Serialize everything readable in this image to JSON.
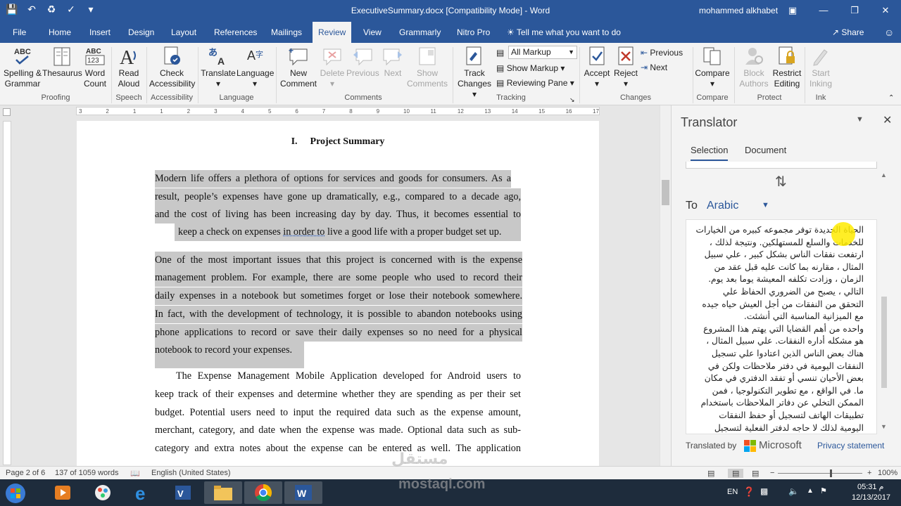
{
  "window": {
    "title": "ExecutiveSummary.docx [Compatibility Mode]  -  Word",
    "user": "mohammed alkhabet"
  },
  "tabs": [
    "File",
    "Home",
    "Insert",
    "Design",
    "Layout",
    "References",
    "Mailings",
    "Review",
    "View",
    "Grammarly",
    "Nitro Pro"
  ],
  "active_tab": "Review",
  "tell_me": "Tell me what you want to do",
  "share": "Share",
  "ribbon": {
    "proofing": {
      "spelling": "Spelling &",
      "spelling2": "Grammar",
      "thesaurus": "Thesaurus",
      "wordcount": "Word",
      "wordcount2": "Count",
      "group": "Proofing"
    },
    "speech": {
      "read": "Read",
      "read2": "Aloud",
      "group": "Speech"
    },
    "accessibility": {
      "check": "Check",
      "check2": "Accessibility",
      "group": "Accessibility"
    },
    "language": {
      "translate": "Translate",
      "language": "Language",
      "group": "Language"
    },
    "comments": {
      "new": "New",
      "new2": "Comment",
      "delete": "Delete",
      "previous": "Previous",
      "next": "Next",
      "show": "Show",
      "show2": "Comments",
      "group": "Comments"
    },
    "tracking": {
      "track": "Track",
      "track2": "Changes",
      "markup": "All Markup",
      "show_markup": "Show Markup",
      "reviewing": "Reviewing Pane",
      "group": "Tracking"
    },
    "changes": {
      "accept": "Accept",
      "reject": "Reject",
      "previous": "Previous",
      "next": "Next",
      "group": "Changes"
    },
    "compare": {
      "compare": "Compare",
      "group": "Compare"
    },
    "protect": {
      "block": "Block",
      "block2": "Authors",
      "restrict": "Restrict",
      "restrict2": "Editing",
      "group": "Protect"
    },
    "ink": {
      "start": "Start",
      "start2": "Inking",
      "group": "Ink"
    }
  },
  "ruler_numbers": [
    "3",
    "2",
    "1",
    "1",
    "2",
    "3",
    "4",
    "5",
    "6",
    "7",
    "8",
    "9",
    "10",
    "11",
    "12",
    "13",
    "14",
    "15",
    "16",
    "17"
  ],
  "document": {
    "heading_num": "I.",
    "heading": "Project Summary",
    "p1": [
      "Modern life offers a plethora of options for services and goods for consumers. As a",
      "result, people’s expenses have gone up dramatically, e.g., compared to a decade ago,",
      "and the cost of living has been increasing day by day. Thus, it becomes essential to"
    ],
    "p1_last_a": "keep a check on expenses ",
    "p1_last_ul": "in order to",
    "p1_last_b": " live a good life with a proper budget set up.",
    "p2": [
      "One of the most important issues that this project is concerned with is the expense",
      "management problem. For example, there are some people who used to record their",
      "daily expenses in a notebook but sometimes forget or lose their notebook somewhere.",
      "In fact, with the development of technology, it is possible to abandon notebooks using",
      "phone applications to record or save their daily expenses so no need for a physical"
    ],
    "p2_last": "notebook to record your expenses.",
    "p3": [
      "The Expense Management Mobile Application developed for Android users to",
      "keep track of their expenses and determine whether they are spending as per their set",
      "budget. Potential users need to input the required data such as the expense amount,",
      "merchant, category, and date when the expense was made. Optional data such as sub-",
      "category and extra notes about the expense can be entered as well. The application"
    ]
  },
  "translator": {
    "title": "Translator",
    "tab_selection": "Selection",
    "tab_document": "Document",
    "to_label": "To",
    "to_language": "Arabic",
    "output": [
      "الحياة الجديدة توفر مجموعه كبيره من الخيارات",
      "للخدمات والسلع للمستهلكين. ونتيجة لذلك ،",
      "ارتفعت نفقات الناس بشكل كبير ، علي سبيل",
      "المثال ، مقارنه بما كانت عليه قبل عقد من",
      "الزمان ، وزادت تكلفه المعيشة يوما بعد يوم.",
      "التالي ، يصبح من الضروري الحفاظ علي",
      "التحقق من النفقات من أجل العيش حياه جيده",
      "مع الميزانية المناسبة التي أنشئت.",
      "واحده من أهم القضايا التي يهتم هذا المشروع",
      "هو مشكله أداره النفقات. علي سبيل المثال ،",
      "هناك بعض الناس الذين اعتادوا علي تسجيل",
      "النفقات اليومية في دفتر ملاحظات ولكن في",
      "بعض الأحيان تنسي أو تفقد الدفتري في مكان",
      "ما. في الواقع ، مع تطوير التكنولوجيا ، فمن",
      "الممكن التخلي عن دفاتر الملاحظات باستخدام",
      "تطبيقات الهاتف لتسجيل أو حفظ النفقات",
      "اليومية لذلك لا حاجه لدفتر الفعلية لتسجيل"
    ],
    "translated_by": "Translated by",
    "provider": "Microsoft",
    "privacy": "Privacy statement"
  },
  "status": {
    "page": "Page 2 of 6",
    "words": "137 of 1059 words",
    "language": "English (United States)",
    "zoom": "100%"
  },
  "tray": {
    "lang": "EN",
    "time": "05:31 م",
    "date": "12/13/2017"
  },
  "watermark": {
    "arabic": "مستقل",
    "latin": "mostaql.com"
  }
}
